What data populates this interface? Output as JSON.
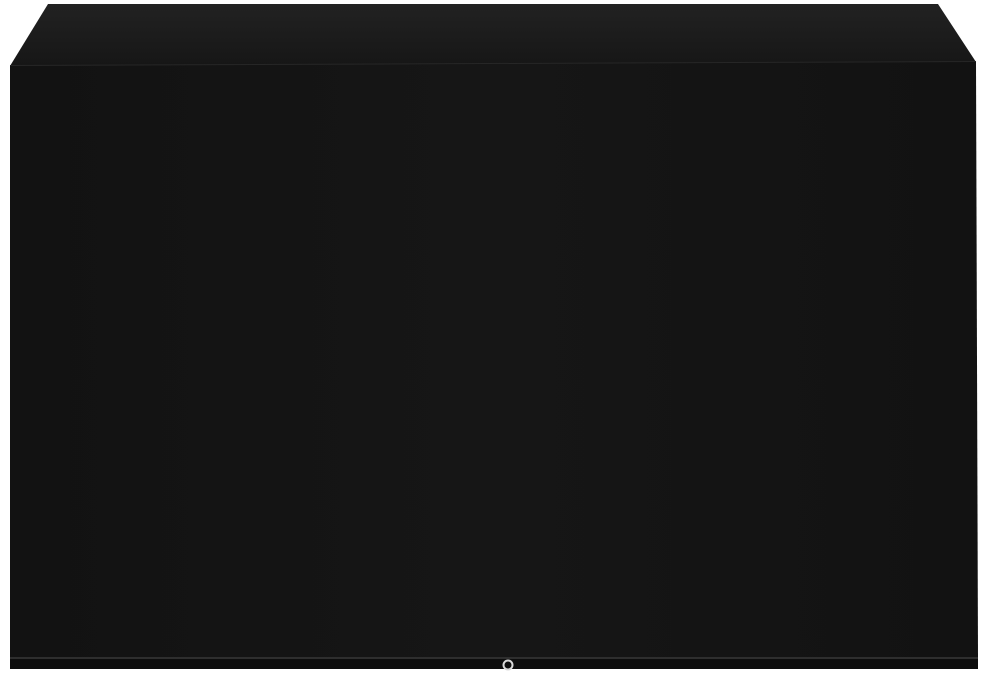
{
  "image": {
    "subject": "black cover",
    "colors": {
      "background": "#ffffff",
      "cover_body": "#141414",
      "cover_top": "#1b1b1b",
      "hem": "#0d0d0d",
      "hem_line": "#3a3a3a",
      "grommet_ring": "#d9d9d9"
    }
  }
}
